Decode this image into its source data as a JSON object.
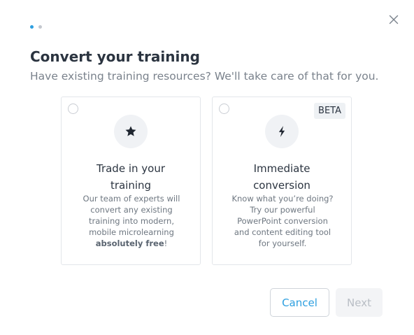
{
  "stepper": {
    "total_steps": 2,
    "current_step": 1
  },
  "dialog": {
    "title": "Convert your training",
    "subtitle": "Have existing training resources? We'll take care of that for you."
  },
  "options": [
    {
      "icon": "star-icon",
      "title_line1": "Trade in your",
      "title_line2": "training",
      "desc_lines": [
        "Our team of experts will",
        "convert any existing",
        "training into modern,",
        "mobile microlearning"
      ],
      "desc_bold": "absolutely free",
      "desc_end": "!",
      "selected": false
    },
    {
      "icon": "lightning-icon",
      "badge": "BETA",
      "title_line1": "Immediate",
      "title_line2": "conversion",
      "desc_lines": [
        "Know what you’re doing?",
        "Try our powerful",
        "PowerPoint conversion",
        "and content editing tool",
        "for yourself."
      ],
      "selected": false
    }
  ],
  "buttons": {
    "cancel_label": "Cancel",
    "next_label": "Next",
    "next_enabled": false
  },
  "colors": {
    "accent": "#2d9fe0",
    "text": "#2b3440",
    "muted": "#7a828c"
  }
}
